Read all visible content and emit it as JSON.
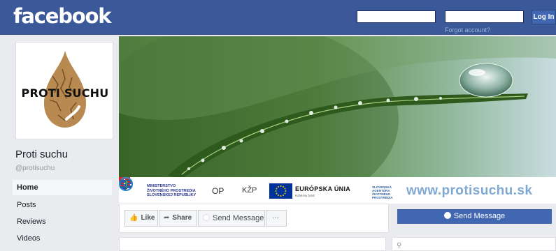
{
  "header": {
    "logo": "facebook",
    "login_button": "Log In",
    "forgot_link": "Forgot account?",
    "email_placeholder": "",
    "password_placeholder": ""
  },
  "profile": {
    "logo_text": "PROTI SUCHU",
    "name": "Proti suchu",
    "handle": "@protisuchu"
  },
  "nav": {
    "items": [
      {
        "label": "Home",
        "active": true
      },
      {
        "label": "Posts",
        "active": false
      },
      {
        "label": "Reviews",
        "active": false
      },
      {
        "label": "Videos",
        "active": false
      }
    ]
  },
  "cover": {
    "ministry_line1": "MINISTERSTVO",
    "ministry_line2": "ŽIVOTNÉHO PROSTREDIA",
    "ministry_line3": "SLOVENSKEJ REPUBLIKY",
    "op_label": "OP",
    "kzp_label": "KŽP",
    "eu_label": "EURÓPSKA ÚNIA",
    "eu_sub": "Kohézny fond",
    "sazp_line1": "SLOVENSKÁ",
    "sazp_line2": "AGENTÚRA",
    "sazp_line3": "ŽIVOTNÉHO",
    "sazp_line4": "PROSTREDIA",
    "url": "www.protisuchu.sk"
  },
  "actions": {
    "like": "Like",
    "share": "Share",
    "send_message": "Send Message",
    "more": "···",
    "primary_send": "Send Message"
  },
  "colors": {
    "brand": "#3b5998",
    "button": "#4267b2",
    "background": "#e9ebee"
  }
}
